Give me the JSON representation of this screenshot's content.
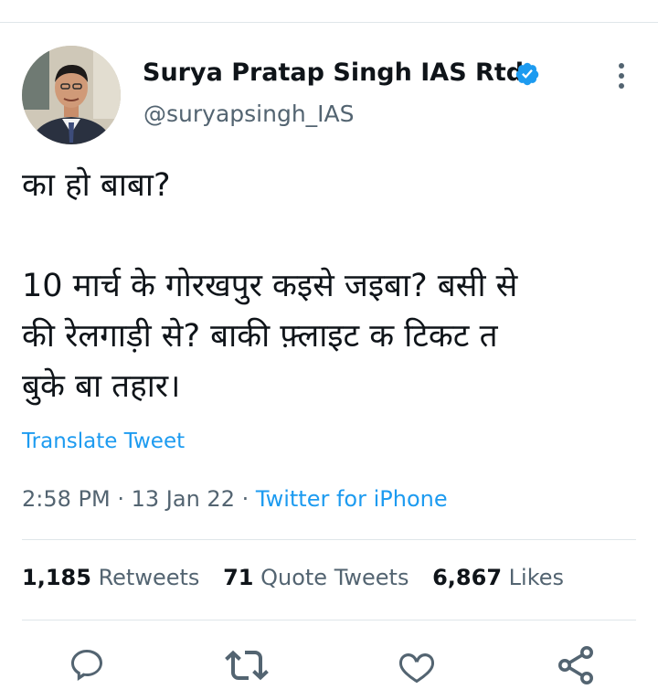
{
  "author": {
    "name": "Surya Pratap Singh IAS Rtd.",
    "handle": "@suryapsingh_IAS",
    "verified": true,
    "verified_color": "#1d9bf0"
  },
  "tweet": {
    "lines": [
      "का हो बाबा?",
      "10 मार्च के गोरखपुर कइसे जइबा? बसी से",
      "की रेलगाड़ी से? बाकी फ़्लाइट क टिकट त",
      "बुके बा तहार।"
    ],
    "translate_label": "Translate Tweet",
    "time": "2:58 PM",
    "separator": "·",
    "date": "13 Jan 22",
    "source": "Twitter for iPhone"
  },
  "stats": {
    "retweets_count": "1,185",
    "retweets_label": "Retweets",
    "quotes_count": "71",
    "quotes_label": "Quote Tweets",
    "likes_count": "6,867",
    "likes_label": "Likes"
  },
  "actions": [
    "reply-icon",
    "retweet-icon",
    "like-icon",
    "share-icon"
  ],
  "colors": {
    "link": "#1d9bf0",
    "secondary": "#536471",
    "text": "#0f1419",
    "divider": "#dfe6ea"
  }
}
